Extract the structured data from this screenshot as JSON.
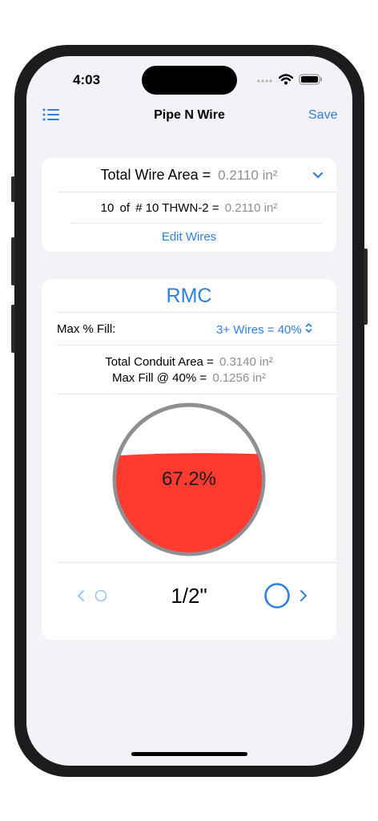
{
  "status_bar": {
    "time": "4:03"
  },
  "nav": {
    "title": "Pipe N Wire",
    "save_label": "Save",
    "list_icon": "list-icon"
  },
  "wire_card": {
    "total_label": "Total Wire Area =",
    "total_value": "0.2110 in²",
    "wire_count": "10",
    "of_label": "of",
    "wire_desc": "# 10 THWN-2 =",
    "wire_value": "0.2110 in²",
    "edit_label": "Edit Wires"
  },
  "conduit_card": {
    "type": "RMC",
    "max_fill_label": "Max % Fill:",
    "max_fill_value": "3+ Wires = 40%",
    "total_area_label": "Total Conduit Area =",
    "total_area_value": "0.3140 in²",
    "max_fill_at_label": "Max Fill @ 40% =",
    "max_fill_at_value": "0.1256 in²",
    "fill_percent_text": "67.2%",
    "fill_level": 0.672,
    "fill_color": "#ff3b30",
    "size_label": "1/2\""
  },
  "colors": {
    "accent": "#2f7fe0",
    "background": "#f2f2f7"
  }
}
